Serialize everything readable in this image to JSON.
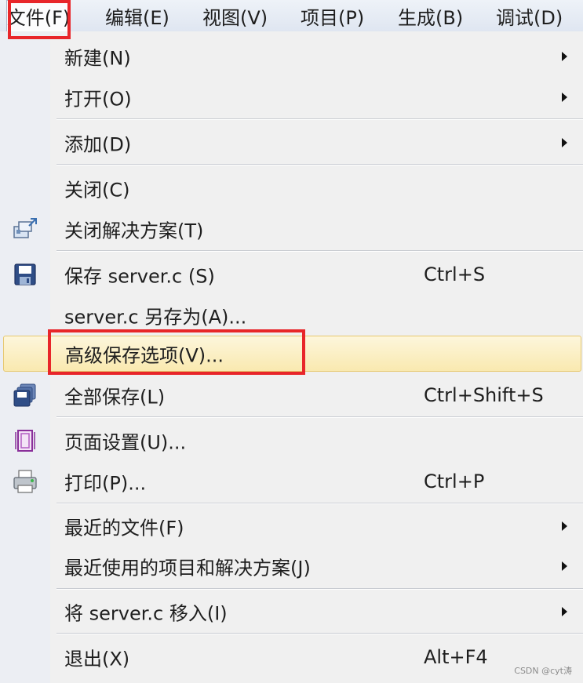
{
  "menubar": {
    "items": [
      {
        "label": "文件(F)"
      },
      {
        "label": "编辑(E)"
      },
      {
        "label": "视图(V)"
      },
      {
        "label": "项目(P)"
      },
      {
        "label": "生成(B)"
      },
      {
        "label": "调试(D)"
      }
    ]
  },
  "file_menu": {
    "items": [
      {
        "label": "新建(N)",
        "submenu": true
      },
      {
        "label": "打开(O)",
        "submenu": true
      },
      {
        "label": "添加(D)",
        "submenu": true
      },
      {
        "label": "关闭(C)"
      },
      {
        "label": "关闭解决方案(T)",
        "icon": "close-solution-icon"
      },
      {
        "label": "保存 server.c (S)",
        "shortcut": "Ctrl+S",
        "icon": "save-icon"
      },
      {
        "label": "server.c 另存为(A)..."
      },
      {
        "label": "高级保存选项(V)...",
        "highlighted": true
      },
      {
        "label": "全部保存(L)",
        "shortcut": "Ctrl+Shift+S",
        "icon": "save-all-icon"
      },
      {
        "label": "页面设置(U)...",
        "icon": "page-setup-icon"
      },
      {
        "label": "打印(P)...",
        "shortcut": "Ctrl+P",
        "icon": "printer-icon"
      },
      {
        "label": "最近的文件(F)",
        "submenu": true
      },
      {
        "label": "最近使用的项目和解决方案(J)",
        "submenu": true
      },
      {
        "label": "将 server.c 移入(I)",
        "submenu": true
      },
      {
        "label": "退出(X)",
        "shortcut": "Alt+F4"
      }
    ]
  },
  "annotation_color": "#e8262a",
  "highlight_color": "#f9e9b0",
  "watermark": "CSDN @cyt涛"
}
